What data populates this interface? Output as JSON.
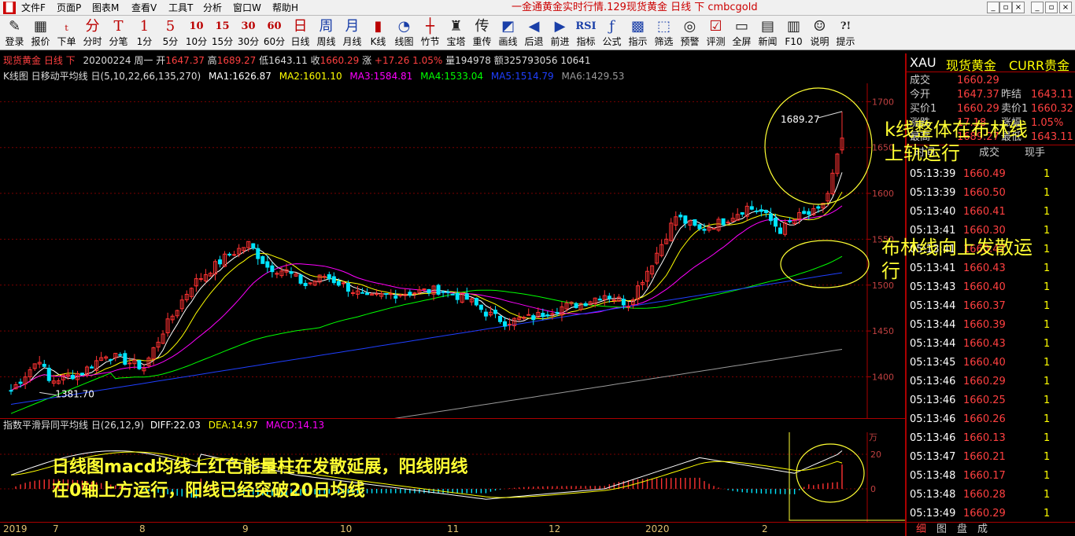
{
  "titlebar": {
    "menus": [
      "文件F",
      "页面P",
      "图表M",
      "查看V",
      "工具T",
      "分析",
      "窗口W",
      "帮助H"
    ],
    "window_title": "一金通黄金实时行情.129现货黄金 日线 下 cmbcgold",
    "min": "_",
    "restore": "▫",
    "close": "×",
    "sub_min": "_",
    "sub_restore": "▫",
    "sub_close": "×"
  },
  "toolbar": [
    {
      "glyph": "✎",
      "label": "登录",
      "color": "dark"
    },
    {
      "glyph": "▦",
      "label": "报价",
      "color": "dark"
    },
    {
      "glyph": "ₜ",
      "label": "下单",
      "color": "red"
    },
    {
      "glyph": "分",
      "label": "分时",
      "color": "red"
    },
    {
      "glyph": "T",
      "label": "分笔",
      "color": "red"
    },
    {
      "glyph": "1",
      "label": "1分",
      "color": "red"
    },
    {
      "glyph": "5",
      "label": "5分",
      "color": "red"
    },
    {
      "glyph": "10",
      "label": "10分",
      "color": "red"
    },
    {
      "glyph": "15",
      "label": "15分",
      "color": "red"
    },
    {
      "glyph": "30",
      "label": "30分",
      "color": "red"
    },
    {
      "glyph": "60",
      "label": "60分",
      "color": "red"
    },
    {
      "glyph": "日",
      "label": "日线",
      "color": "red"
    },
    {
      "glyph": "周",
      "label": "周线",
      "color": "blue"
    },
    {
      "glyph": "月",
      "label": "月线",
      "color": "blue"
    },
    {
      "glyph": "▮",
      "label": "K线",
      "color": "red"
    },
    {
      "glyph": "◔",
      "label": "线图",
      "color": "blue"
    },
    {
      "glyph": "┼",
      "label": "竹节",
      "color": "red"
    },
    {
      "glyph": "♜",
      "label": "宝塔",
      "color": "dark"
    },
    {
      "glyph": "传",
      "label": "重传",
      "color": "dark"
    },
    {
      "glyph": "◩",
      "label": "画线",
      "color": "blue"
    },
    {
      "glyph": "◀",
      "label": "后退",
      "color": "blue"
    },
    {
      "glyph": "▶",
      "label": "前进",
      "color": "blue"
    },
    {
      "glyph": "RSI",
      "label": "指标",
      "color": "blue"
    },
    {
      "glyph": "ƒ",
      "label": "公式",
      "color": "blue"
    },
    {
      "glyph": "▩",
      "label": "指示",
      "color": "blue"
    },
    {
      "glyph": "⬚",
      "label": "筛选",
      "color": "blue"
    },
    {
      "glyph": "◎",
      "label": "预警",
      "color": "dark"
    },
    {
      "glyph": "☑",
      "label": "评测",
      "color": "red"
    },
    {
      "glyph": "▭",
      "label": "全屏",
      "color": "dark"
    },
    {
      "glyph": "▤",
      "label": "新闻",
      "color": "dark"
    },
    {
      "glyph": "▥",
      "label": "F10",
      "color": "dark"
    },
    {
      "glyph": "☺",
      "label": "说明",
      "color": "dark"
    },
    {
      "glyph": "?!",
      "label": "提示",
      "color": "dark"
    }
  ],
  "infobar": {
    "name": "现货黄金 日线 下",
    "date": "20200224 周一",
    "open_label": "开",
    "open": "1647.37",
    "high_label": "高",
    "high": "1689.27",
    "low_label": "低",
    "low": "1643.11",
    "close_label": "收",
    "close": "1660.29",
    "chg_label": "涨",
    "chg": "+17.26 1.05%",
    "vol_label": "量",
    "vol": "194978",
    "amt_label": "额",
    "amt": "325793056",
    "extra": "10641"
  },
  "mabar": {
    "title": "K线图 日移动平均线 日(5,10,22,66,135,270)",
    "ma1": "MA1:1626.87",
    "ma2": "MA2:1601.10",
    "ma3": "MA3:1584.81",
    "ma4": "MA4:1533.04",
    "ma5": "MA5:1514.79",
    "ma6": "MA6:1429.53"
  },
  "colors": {
    "ma1": "#ffffff",
    "ma2": "#ffff00",
    "ma3": "#ff00ff",
    "ma4": "#00ff00",
    "ma5": "#1f3fff",
    "ma6": "#9a9a9a",
    "up": "#ff3232",
    "down": "#00e5ff",
    "grid": "#7a0000",
    "annot": "#ffff33"
  },
  "chart_data": [
    {
      "type": "candlestick",
      "title": "现货黄金 日线",
      "ylim": [
        1355,
        1720
      ],
      "yticks": [
        1400,
        1450,
        1500,
        1550,
        1600,
        1650,
        1700
      ],
      "xticks": [
        "2019",
        "7",
        "8",
        "9",
        "10",
        "11",
        "12",
        "2020",
        "2"
      ],
      "labels": {
        "high_mark": "1689.27",
        "low_mark": "1381.70"
      },
      "ma": {
        "MA1": 1626.87,
        "MA2": 1601.1,
        "MA3": 1584.81,
        "MA4": 1533.04,
        "MA5": 1514.79,
        "MA6": 1429.53
      },
      "last": {
        "open": 1647.37,
        "high": 1689.27,
        "low": 1643.11,
        "close": 1660.29
      }
    },
    {
      "type": "bar",
      "title": "指数平滑异同平均线 日(26,12,9)",
      "series": [
        {
          "name": "DIFF",
          "value": 22.03
        },
        {
          "name": "DEA",
          "value": 14.97
        },
        {
          "name": "MACD",
          "value": 14.13
        }
      ],
      "yticks": [
        0,
        20
      ],
      "y_unit": "万"
    }
  ],
  "macd_bar": {
    "title": "指数平滑异同平均线 日(26,12,9)",
    "diff": "DIFF:22.03",
    "dea": "DEA:14.97",
    "macd": "MACD:14.13",
    "unit": "万",
    "tick20": "20",
    "tick0": "0"
  },
  "yaxis": [
    "1700",
    "1650",
    "1600",
    "1550",
    "1500",
    "1450",
    "1400"
  ],
  "xaxis": [
    "2019",
    "7",
    "8",
    "9",
    "10",
    "11",
    "12",
    "2020",
    "2"
  ],
  "chart_labels": {
    "high": "1689.27",
    "low": "1381.70"
  },
  "rpanel": {
    "code": "XAU",
    "name": "现货黄金",
    "category": "CURR贵金",
    "rows": [
      {
        "k": "成交",
        "v": "1660.29",
        "k2": "",
        "v2": ""
      },
      {
        "k": "今开",
        "v": "1647.37",
        "k2": "昨结",
        "v2": "1643.11"
      },
      {
        "k": "买价1",
        "v": "1660.29",
        "k2": "卖价1",
        "v2": "1660.32"
      },
      {
        "k": "涨跌",
        "v": "17.18",
        "k2": "涨幅",
        "v2": "1.05%"
      },
      {
        "k": "最高",
        "v": "1689.27",
        "k2": "最低",
        "v2": "1643.11"
      }
    ],
    "tick_head": {
      "time": "时间",
      "price": "成交",
      "qty": "现手"
    },
    "ticks": [
      {
        "t": "05:13:39",
        "p": "1660.49",
        "q": "1"
      },
      {
        "t": "05:13:39",
        "p": "1660.50",
        "q": "1"
      },
      {
        "t": "05:13:40",
        "p": "1660.41",
        "q": "1"
      },
      {
        "t": "05:13:41",
        "p": "1660.30",
        "q": "1"
      },
      {
        "t": "05:13:41",
        "p": "1660.42",
        "q": "1"
      },
      {
        "t": "05:13:41",
        "p": "1660.43",
        "q": "1"
      },
      {
        "t": "05:13:43",
        "p": "1660.40",
        "q": "1"
      },
      {
        "t": "05:13:44",
        "p": "1660.37",
        "q": "1"
      },
      {
        "t": "05:13:44",
        "p": "1660.39",
        "q": "1"
      },
      {
        "t": "05:13:44",
        "p": "1660.43",
        "q": "1"
      },
      {
        "t": "05:13:45",
        "p": "1660.40",
        "q": "1"
      },
      {
        "t": "05:13:46",
        "p": "1660.29",
        "q": "1"
      },
      {
        "t": "05:13:46",
        "p": "1660.25",
        "q": "1"
      },
      {
        "t": "05:13:46",
        "p": "1660.26",
        "q": "1"
      },
      {
        "t": "05:13:46",
        "p": "1660.13",
        "q": "1"
      },
      {
        "t": "05:13:47",
        "p": "1660.21",
        "q": "1"
      },
      {
        "t": "05:13:48",
        "p": "1660.17",
        "q": "1"
      },
      {
        "t": "05:13:48",
        "p": "1660.28",
        "q": "1"
      },
      {
        "t": "05:13:49",
        "p": "1660.29",
        "q": "1"
      }
    ],
    "tabs": [
      "细",
      "图",
      "盘",
      "成"
    ]
  },
  "annotations": {
    "a1_line1": "k线整体在布林线",
    "a1_line2": "上轨运行",
    "a2_line1": "布林线向上发散运",
    "a2_line2": "行",
    "a3_line1": "日线图macd均线上红色能量柱在发散延展，阳线阴线",
    "a3_line2": "在0轴上方运行，阳线已经突破20日均线"
  }
}
